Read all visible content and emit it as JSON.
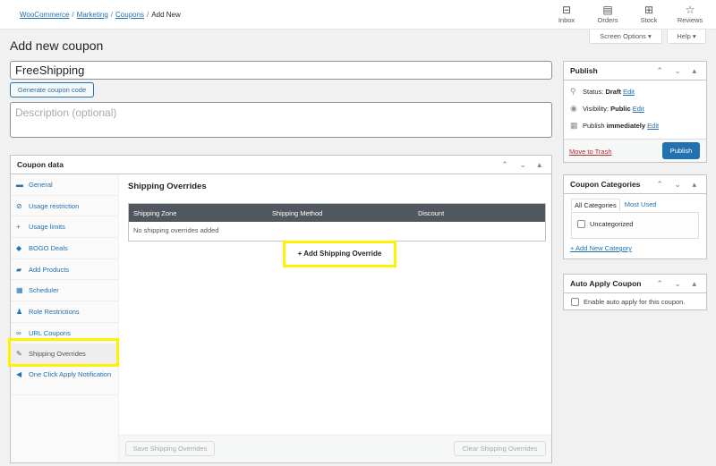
{
  "breadcrumb": {
    "items": [
      "WooCommerce",
      "Marketing",
      "Coupons"
    ],
    "current": "Add New"
  },
  "activity": [
    {
      "icon": "inbox-icon",
      "glyph": "⊟",
      "label": "Inbox"
    },
    {
      "icon": "orders-icon",
      "glyph": "▤",
      "label": "Orders"
    },
    {
      "icon": "stock-icon",
      "glyph": "⊞",
      "label": "Stock"
    },
    {
      "icon": "reviews-icon",
      "glyph": "☆",
      "label": "Reviews"
    }
  ],
  "screen_options": "Screen Options ▾",
  "help": "Help ▾",
  "page_title": "Add new coupon",
  "coupon_code": "FreeShipping",
  "generate_label": "Generate coupon code",
  "description_placeholder": "Description (optional)",
  "coupon_data": {
    "title": "Coupon data",
    "tabs": [
      {
        "icon": "ticket-icon",
        "glyph": "▬",
        "label": "General"
      },
      {
        "icon": "restriction-icon",
        "glyph": "⊘",
        "label": "Usage restriction"
      },
      {
        "icon": "limits-icon",
        "glyph": "+",
        "label": "Usage limits"
      },
      {
        "icon": "bogo-icon",
        "glyph": "◆",
        "label": "BOGO Deals"
      },
      {
        "icon": "products-icon",
        "glyph": "▰",
        "label": "Add Products"
      },
      {
        "icon": "calendar-icon",
        "glyph": "▦",
        "label": "Scheduler"
      },
      {
        "icon": "user-icon",
        "glyph": "♟",
        "label": "Role Restrictions"
      },
      {
        "icon": "link-icon",
        "glyph": "∞",
        "label": "URL Coupons"
      },
      {
        "icon": "wrench-icon",
        "glyph": "✎",
        "label": "Shipping Overrides"
      },
      {
        "icon": "megaphone-icon",
        "glyph": "◀",
        "label": "One Click Apply Notification"
      }
    ],
    "section_title": "Shipping Overrides",
    "columns": [
      "Shipping Zone",
      "Shipping Method",
      "Discount"
    ],
    "empty": "No shipping overrides added",
    "add_label": "+ Add Shipping Override",
    "save_label": "Save Shipping Overrides",
    "clear_label": "Clear Shipping Overrides"
  },
  "publish": {
    "title": "Publish",
    "status_label": "Status:",
    "status": "Draft",
    "visibility_label": "Visibility:",
    "visibility": "Public",
    "publish_label": "Publish",
    "publish_value": "immediately",
    "edit": "Edit",
    "trash": "Move to Trash",
    "button": "Publish"
  },
  "categories": {
    "title": "Coupon Categories",
    "tab_all": "All Categories",
    "tab_used": "Most Used",
    "item": "Uncategorized",
    "add": "+ Add New Category"
  },
  "auto_apply": {
    "title": "Auto Apply Coupon",
    "label": "Enable auto apply for this coupon."
  },
  "controls": "⌃ ⌄ ▴"
}
